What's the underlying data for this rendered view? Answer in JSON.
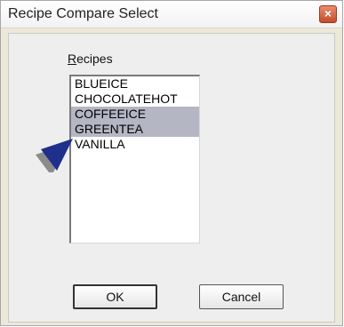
{
  "window": {
    "title": "Recipe Compare Select",
    "close_glyph": "×"
  },
  "label": {
    "accesskey": "R",
    "rest": "ecipes"
  },
  "recipes": [
    {
      "name": "BLUEICE",
      "selected": false
    },
    {
      "name": "CHOCOLATEHOT",
      "selected": false
    },
    {
      "name": "COFFEEICE",
      "selected": true
    },
    {
      "name": "GREENTEA",
      "selected": true
    },
    {
      "name": "VANILLA",
      "selected": false
    }
  ],
  "buttons": {
    "ok": "OK",
    "cancel": "Cancel"
  },
  "pointer": {
    "icon": "arrow-pointer-icon",
    "color": "#1e2f8c",
    "shadow": "#8c8c8c"
  }
}
